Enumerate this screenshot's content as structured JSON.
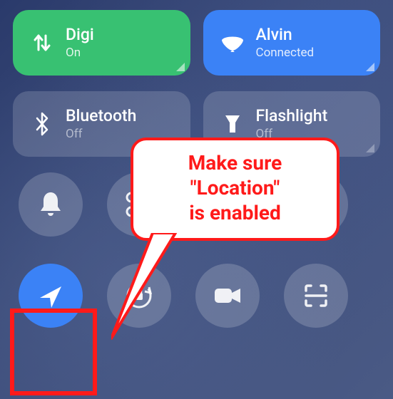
{
  "tiles": {
    "mobile_data": {
      "title": "Digi",
      "status": "On"
    },
    "wifi": {
      "title": "Alvin",
      "status": "Connected"
    },
    "bluetooth": {
      "title": "Bluetooth",
      "status": "Off"
    },
    "flashlight": {
      "title": "Flashlight",
      "status": "Off"
    }
  },
  "callout": {
    "line1": "Make sure",
    "line2": "\"Location\"",
    "line3": "is enabled"
  },
  "colors": {
    "highlight": "#ff1a1a",
    "active": "#3b82f6",
    "success": "#38c172"
  }
}
